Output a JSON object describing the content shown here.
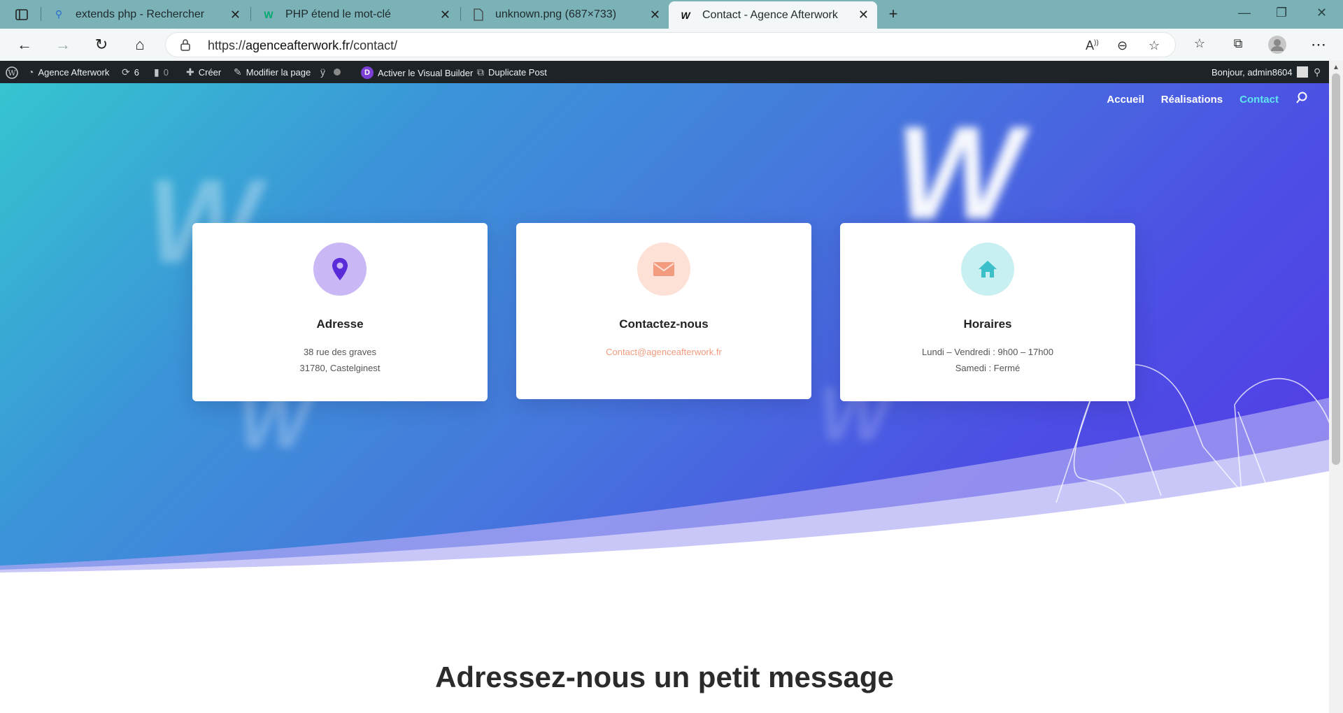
{
  "browser": {
    "tabs": [
      {
        "title": "extends php - Rechercher",
        "icon": "search-icon"
      },
      {
        "title": "PHP étend le mot-clé",
        "icon": "w3-icon"
      },
      {
        "title": "unknown.png (687×733)",
        "icon": "file-icon"
      },
      {
        "title": "Contact - Agence Afterwork",
        "icon": "afterwork-logo-icon"
      }
    ],
    "url_prefix": "https://",
    "url_host": "agenceafterwork.fr",
    "url_path": "/contact/"
  },
  "wpbar": {
    "site": "Agence Afterwork",
    "updates": "6",
    "comments": "0",
    "create": "Créer",
    "edit": "Modifier la page",
    "visual_builder": "Activer le Visual Builder",
    "duplicate": "Duplicate Post",
    "greeting": "Bonjour, admin8604"
  },
  "nav": {
    "items": [
      "Accueil",
      "Réalisations",
      "Contact"
    ],
    "active_color": "#5fe4f0"
  },
  "cards": [
    {
      "title": "Adresse",
      "lines": [
        "38 rue des graves",
        "31780, Castelginest"
      ],
      "icon": "location-pin-icon",
      "icon_bg": "#c9b8f5",
      "icon_color": "#5a2bd8"
    },
    {
      "title": "Contactez-nous",
      "email": "Contact@agenceafterwork.fr",
      "icon": "envelope-icon",
      "icon_bg": "#fde0d6",
      "icon_color": "#f39b7e"
    },
    {
      "title": "Horaires",
      "lines": [
        "Lundi – Vendredi : 9h00 – 17h00",
        "Samedi : Fermé"
      ],
      "icon": "home-icon",
      "icon_bg": "#c8f0f2",
      "icon_color": "#3bbfc8"
    }
  ],
  "section": {
    "heading": "Adressez-nous un petit message"
  },
  "colors": {
    "hero_start": "#35c5d0",
    "hero_end": "#5538e8",
    "email": "#f39b7e"
  }
}
